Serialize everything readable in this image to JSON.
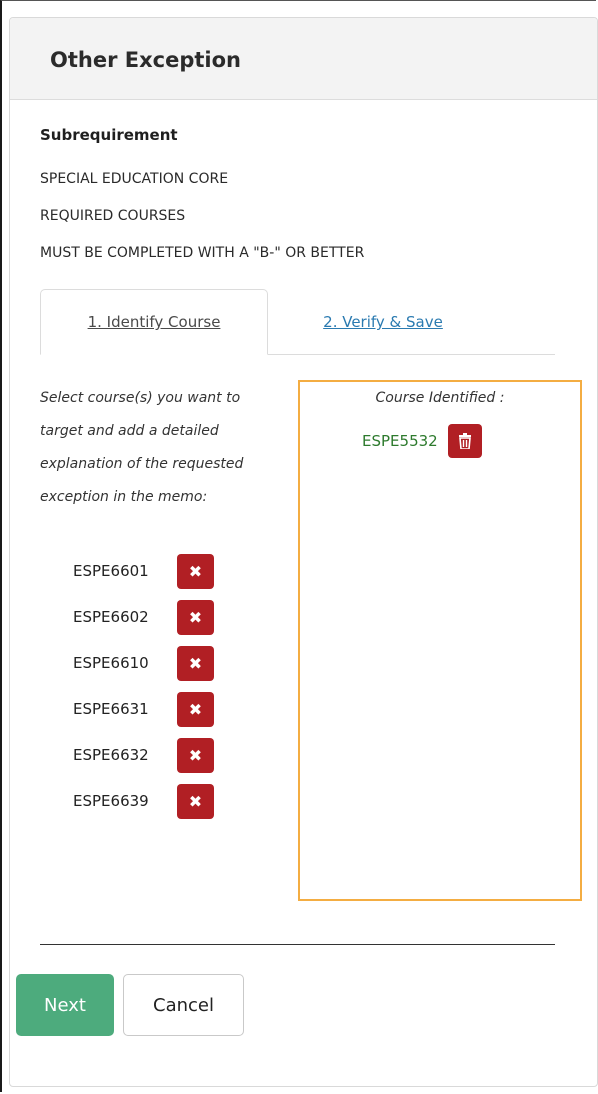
{
  "header": {
    "title": "Other Exception"
  },
  "subrequirement": {
    "label": "Subrequirement",
    "lines": [
      "SPECIAL EDUCATION CORE",
      "REQUIRED COURSES",
      "MUST BE COMPLETED WITH A \"B-\" OR BETTER"
    ]
  },
  "tabs": [
    {
      "label": "1. Identify Course",
      "active": true
    },
    {
      "label": "2. Verify & Save",
      "active": false
    }
  ],
  "instructions": "Select course(s) you want to target and add a detailed explanation of the requested exception in the memo:",
  "courses": [
    {
      "code": "ESPE6601",
      "remove_icon": "x-icon"
    },
    {
      "code": "ESPE6602",
      "remove_icon": "x-icon"
    },
    {
      "code": "ESPE6610",
      "remove_icon": "x-icon"
    },
    {
      "code": "ESPE6631",
      "remove_icon": "x-icon"
    },
    {
      "code": "ESPE6632",
      "remove_icon": "x-icon"
    },
    {
      "code": "ESPE6639",
      "remove_icon": "x-icon"
    }
  ],
  "identified": {
    "label": "Course Identified :",
    "code": "ESPE5532",
    "delete_icon": "trash-icon"
  },
  "footer": {
    "next_label": "Next",
    "cancel_label": "Cancel"
  },
  "colors": {
    "danger": "#b11f24",
    "success": "#4dab7d",
    "highlight_border": "#f4ad42",
    "identified_text": "#2d7a2d",
    "link": "#2a7ab0"
  }
}
